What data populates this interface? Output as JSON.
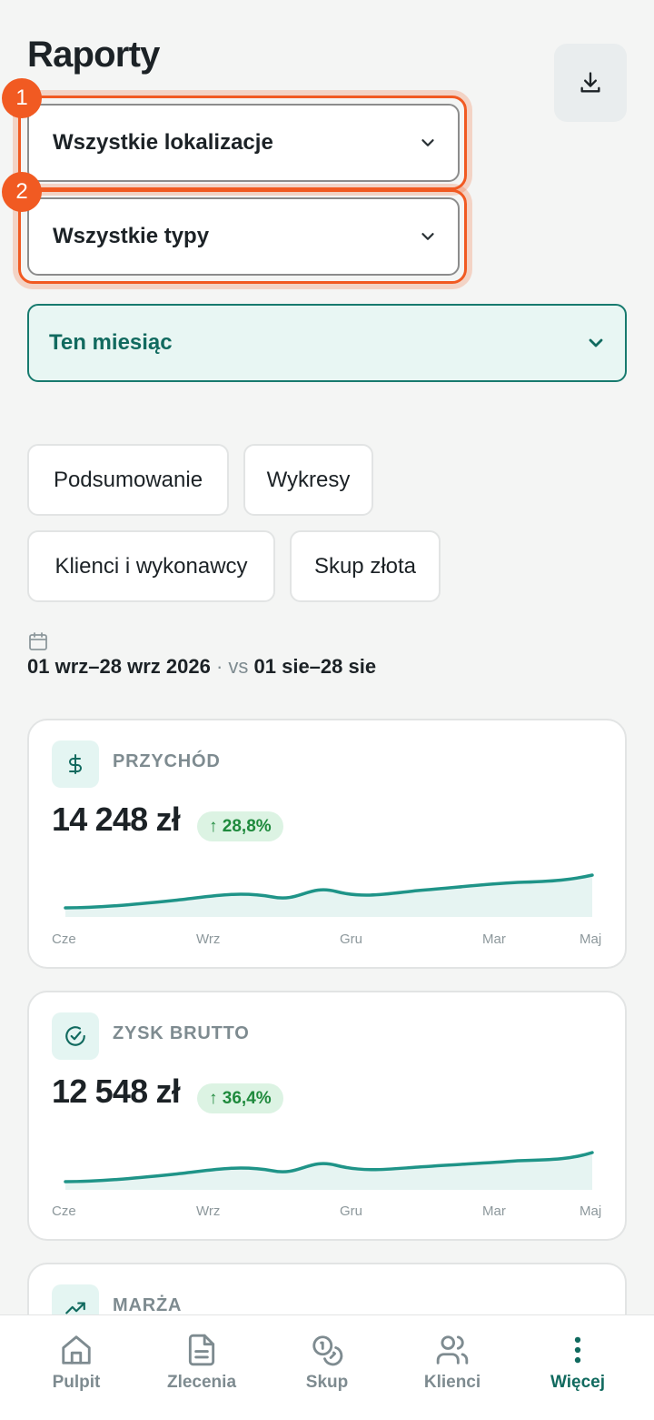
{
  "header": {
    "title": "Raporty",
    "download_icon": "download-icon"
  },
  "filters": [
    {
      "badge": "1",
      "label": "Wszystkie lokalizacje"
    },
    {
      "badge": "2",
      "label": "Wszystkie typy"
    }
  ],
  "period": {
    "label": "Ten miesiąc"
  },
  "tabs": [
    "Podsumowanie",
    "Wykresy",
    "Klienci i wykonawcy",
    "Skup złota"
  ],
  "range": {
    "current": "01 wrz–28 wrz 2026",
    "separator": "·",
    "vs": "vs",
    "previous": "01 sie–28 sie"
  },
  "cards": [
    {
      "label": "PRZYCHÓD",
      "icon": "dollar-icon",
      "value": "14 248 zł",
      "change": "↑ 28,8%",
      "axis": [
        "Cze",
        "Wrz",
        "Gru",
        "Mar",
        "Maj"
      ]
    },
    {
      "label": "ZYSK BRUTTO",
      "icon": "check-circle-icon",
      "value": "12 548 zł",
      "change": "↑ 36,4%",
      "axis": [
        "Cze",
        "Wrz",
        "Gru",
        "Mar",
        "Maj"
      ]
    },
    {
      "label": "MARŻA",
      "icon": "trending-up-icon"
    }
  ],
  "nav": [
    {
      "label": "Pulpit",
      "icon": "home-icon",
      "active": false
    },
    {
      "label": "Zlecenia",
      "icon": "document-icon",
      "active": false
    },
    {
      "label": "Skup",
      "icon": "coins-icon",
      "active": false
    },
    {
      "label": "Klienci",
      "icon": "users-icon",
      "active": false
    },
    {
      "label": "Więcej",
      "icon": "more-vertical-icon",
      "active": true
    }
  ],
  "colors": {
    "accent": "#116a5f",
    "highlight": "#f15a22",
    "positive": "#1f8a3d",
    "background": "#f4f5f4"
  }
}
